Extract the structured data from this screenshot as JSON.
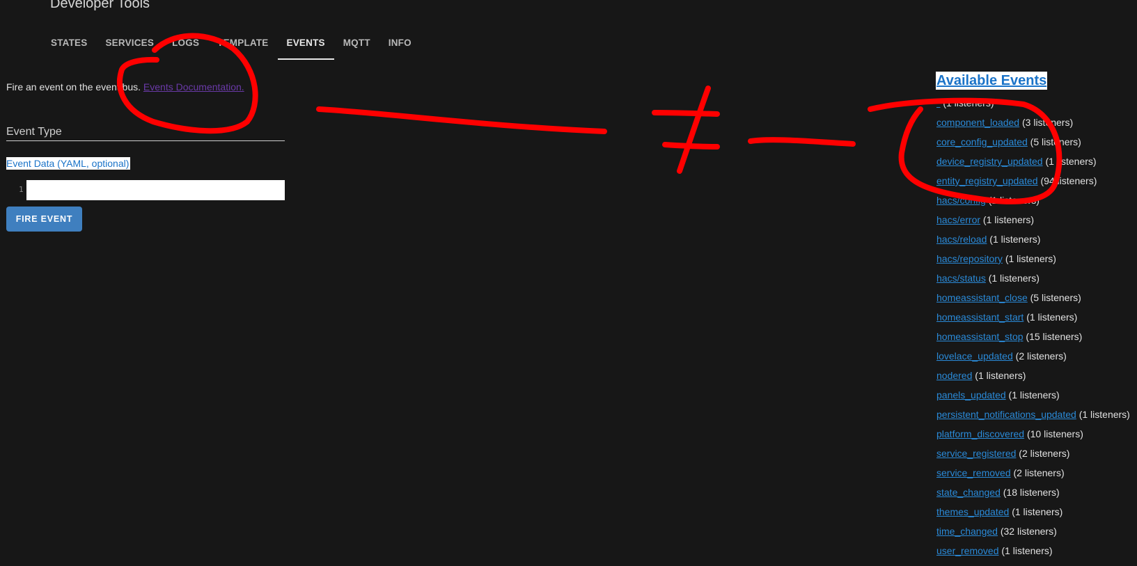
{
  "header": {
    "title": "Developer Tools"
  },
  "tabs": [
    {
      "label": "STATES"
    },
    {
      "label": "SERVICES"
    },
    {
      "label": "LOGS"
    },
    {
      "label": "TEMPLATE"
    },
    {
      "label": "EVENTS",
      "active": true
    },
    {
      "label": "MQTT"
    },
    {
      "label": "INFO"
    }
  ],
  "fire_panel": {
    "intro_text": "Fire an event on the event bus.",
    "doc_link": "Events Documentation.",
    "event_type_label": "Event Type",
    "event_data_label": "Event Data (YAML, optional)",
    "line_number": "1",
    "event_data_value": "",
    "fire_button": "FIRE EVENT"
  },
  "available_events": {
    "title": "Available Events",
    "items": [
      {
        "name": "*",
        "count": "(1 listeners)"
      },
      {
        "name": "component_loaded",
        "count": "(3 listeners)"
      },
      {
        "name": "core_config_updated",
        "count": "(5 listeners)"
      },
      {
        "name": "device_registry_updated",
        "count": "(1 listeners)"
      },
      {
        "name": "entity_registry_updated",
        "count": "(94 listeners)"
      },
      {
        "name": "hacs/config",
        "count": "(1 listeners)"
      },
      {
        "name": "hacs/error",
        "count": "(1 listeners)"
      },
      {
        "name": "hacs/reload",
        "count": "(1 listeners)"
      },
      {
        "name": "hacs/repository",
        "count": "(1 listeners)"
      },
      {
        "name": "hacs/status",
        "count": "(1 listeners)"
      },
      {
        "name": "homeassistant_close",
        "count": "(5 listeners)"
      },
      {
        "name": "homeassistant_start",
        "count": "(1 listeners)"
      },
      {
        "name": "homeassistant_stop",
        "count": "(15 listeners)"
      },
      {
        "name": "lovelace_updated",
        "count": "(2 listeners)"
      },
      {
        "name": "nodered",
        "count": "(1 listeners)"
      },
      {
        "name": "panels_updated",
        "count": "(1 listeners)"
      },
      {
        "name": "persistent_notifications_updated",
        "count": "(1 listeners)"
      },
      {
        "name": "platform_discovered",
        "count": "(10 listeners)"
      },
      {
        "name": "service_registered",
        "count": "(2 listeners)"
      },
      {
        "name": "service_removed",
        "count": "(2 listeners)"
      },
      {
        "name": "state_changed",
        "count": "(18 listeners)"
      },
      {
        "name": "themes_updated",
        "count": "(1 listeners)"
      },
      {
        "name": "time_changed",
        "count": "(32 listeners)"
      },
      {
        "name": "user_removed",
        "count": "(1 listeners)"
      }
    ]
  },
  "colors": {
    "background": "#171717",
    "link": "#2a8ad8",
    "visited_link": "#6a3aa8",
    "button": "#3f7fbf",
    "annotation": "#ff0000"
  }
}
